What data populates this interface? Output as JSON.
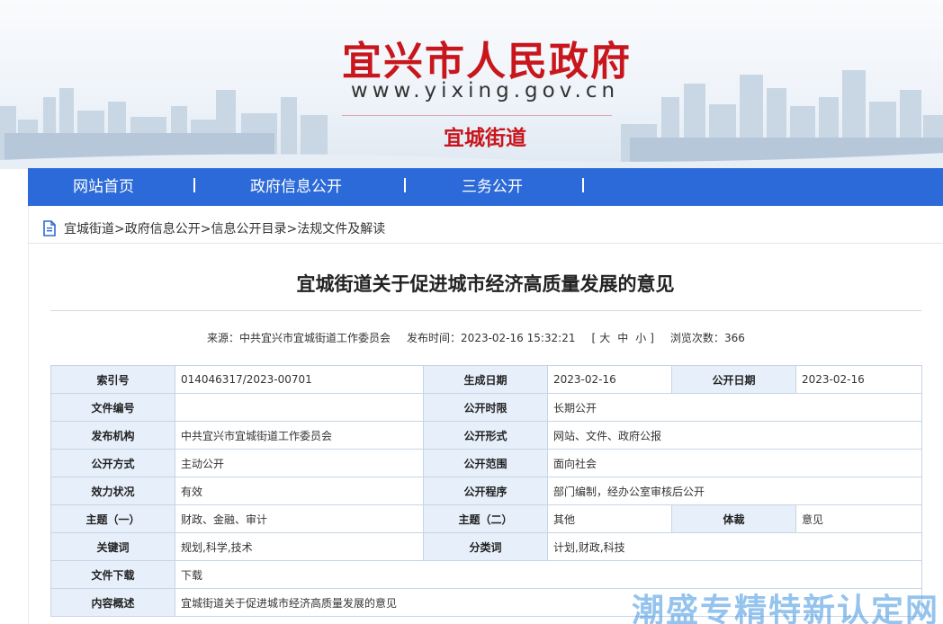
{
  "header": {
    "site_title": "宜兴市人民政府",
    "site_url": "www.yixing.gov.cn",
    "sub_title": "宜城街道"
  },
  "nav": {
    "items": [
      {
        "label": "网站首页"
      },
      {
        "label": "政府信息公开"
      },
      {
        "label": "三务公开"
      }
    ]
  },
  "breadcrumb": {
    "items": [
      "宜城街道",
      "政府信息公开",
      "信息公开目录",
      "法规文件及解读"
    ],
    "separator": ">"
  },
  "article": {
    "title": "宜城街道关于促进城市经济高质量发展的意见",
    "source_label": "来源：",
    "source": "中共宜兴市宜城街道工作委员会",
    "time_label": "发布时间：",
    "time": "2023-02-16 15:32:21",
    "size_open": "[",
    "size_large": "大",
    "size_medium": "中",
    "size_small": "小",
    "size_close": "]",
    "views_label": "浏览次数：",
    "views": "366"
  },
  "info_table": {
    "index_no_label": "索引号",
    "index_no": "014046317/2023-00701",
    "gen_date_label": "生成日期",
    "gen_date": "2023-02-16",
    "pub_date_label": "公开日期",
    "pub_date": "2023-02-16",
    "doc_no_label": "文件编号",
    "doc_no": "",
    "pub_limit_label": "公开时限",
    "pub_limit": "长期公开",
    "issuer_label": "发布机构",
    "issuer": "中共宜兴市宜城街道工作委员会",
    "pub_form_label": "公开形式",
    "pub_form": "网站、文件、政府公报",
    "pub_method_label": "公开方式",
    "pub_method": "主动公开",
    "pub_scope_label": "公开范围",
    "pub_scope": "面向社会",
    "validity_label": "效力状况",
    "validity": "有效",
    "pub_proc_label": "公开程序",
    "pub_proc": "部门编制，经办公室审核后公开",
    "topic1_label": "主题（一）",
    "topic1": "财政、金融、审计",
    "topic2_label": "主题（二）",
    "topic2": "其他",
    "genre_label": "体裁",
    "genre": "意见",
    "keywords_label": "关键词",
    "keywords": "规划,科学,技术",
    "category_label": "分类词",
    "category": "计划,财政,科技",
    "download_label": "文件下载",
    "download": "下载",
    "summary_label": "内容概述",
    "summary": "宜城街道关于促进城市经济高质量发展的意见"
  },
  "watermark": "潮盛专精特新认定网",
  "colors": {
    "brand_red": "#c8161d",
    "nav_blue": "#2b6ad8",
    "label_bg": "#e6effa",
    "border": "#c7d5e6"
  }
}
